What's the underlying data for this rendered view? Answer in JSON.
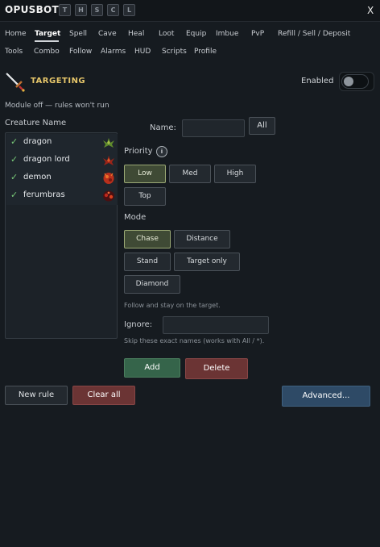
{
  "app": {
    "title": "OPUSBOT",
    "mini_buttons": [
      "T",
      "H",
      "S",
      "C",
      "L"
    ],
    "close": "X"
  },
  "tabs_row1": [
    "Home",
    "Target",
    "Spell",
    "Cave",
    "Heal",
    "Loot",
    "Equip",
    "Imbue",
    "PvP",
    "Refill / Sell / Deposit"
  ],
  "tabs_row2": [
    "Tools",
    "Combo",
    "Follow",
    "Alarms",
    "HUD",
    "Scripts",
    "Profile"
  ],
  "active_tab": "Target",
  "targeting": {
    "title": "TARGETING",
    "enabled_label": "Enabled",
    "enabled": false,
    "status": "Module off — rules won't run"
  },
  "creature_list": {
    "header": "Creature Name",
    "items": [
      {
        "name": "dragon",
        "checked": true,
        "icon": "dragon-icon"
      },
      {
        "name": "dragon lord",
        "checked": true,
        "icon": "dragon-lord-icon"
      },
      {
        "name": "demon",
        "checked": true,
        "icon": "demon-icon"
      },
      {
        "name": "ferumbras",
        "checked": true,
        "icon": "ferumbras-icon"
      }
    ]
  },
  "form": {
    "name_label": "Name:",
    "name_value": "",
    "all_button": "All",
    "priority_label": "Priority",
    "priority_info": "i",
    "priority_options": [
      "Low",
      "Med",
      "High",
      "Top"
    ],
    "priority_selected": "Low",
    "mode_label": "Mode",
    "mode_options": [
      "Chase",
      "Distance",
      "Stand",
      "Target only",
      "Diamond"
    ],
    "mode_selected": "Chase",
    "mode_hint": "Follow and stay on the target.",
    "ignore_label": "Ignore:",
    "ignore_value": "",
    "ignore_hint": "Skip these exact names (works with All / *).",
    "add_button": "Add",
    "delete_button": "Delete"
  },
  "footer": {
    "new_rule": "New rule",
    "clear_all": "Clear all",
    "advanced": "Advanced..."
  },
  "colors": {
    "accent_gold": "#e6c66a",
    "add_green": "#35644a",
    "delete_red": "#6b3434",
    "advanced_blue": "#2e4a66",
    "selected_olive": "#3f4a35"
  }
}
